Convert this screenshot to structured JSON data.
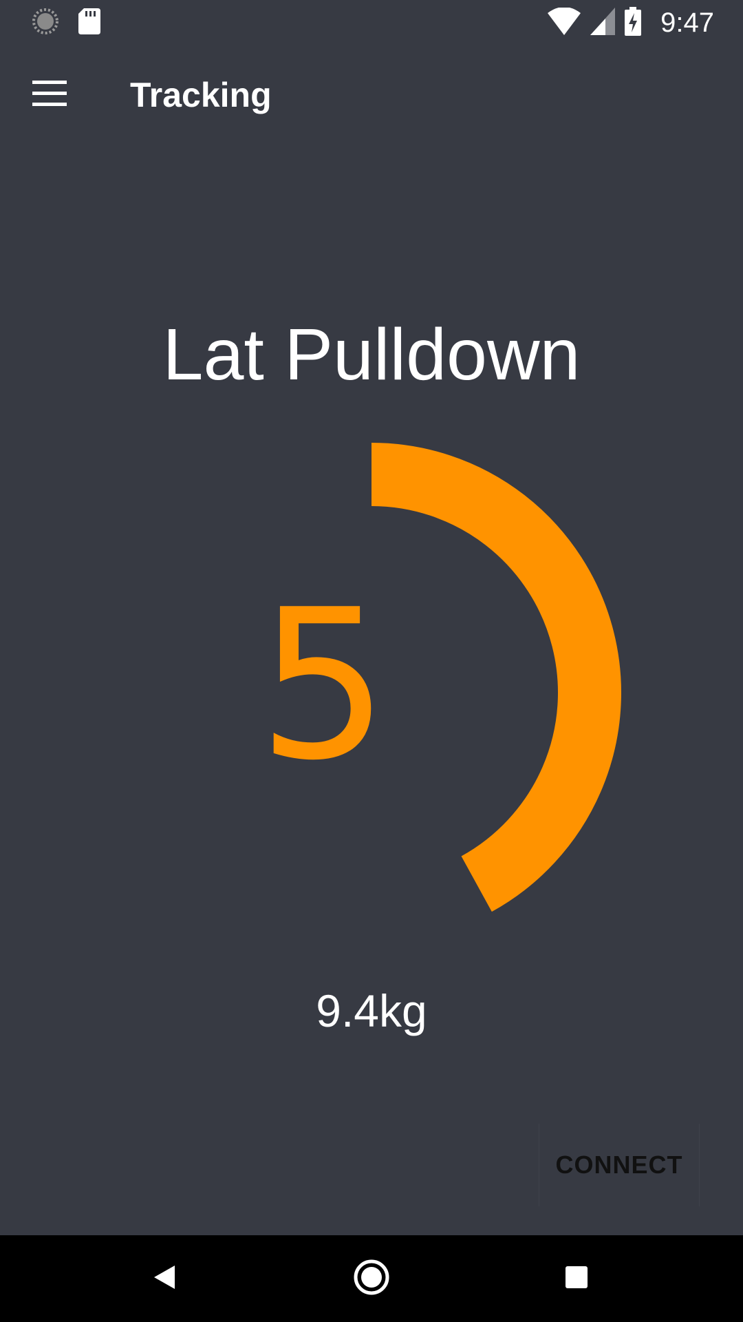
{
  "status_bar": {
    "time": "9:47",
    "icons": [
      "loading-spinner-icon",
      "sd-card-icon",
      "wifi-icon",
      "cell-signal-icon",
      "battery-charging-icon"
    ]
  },
  "app_bar": {
    "menu_icon": "hamburger-menu-icon",
    "title": "Tracking"
  },
  "tracker": {
    "exercise_name": "Lat Pulldown",
    "rep_count": "5",
    "weight": "9.4kg",
    "progress_fraction": 0.42,
    "accent_color": "#ff9300"
  },
  "actions": {
    "connect_label": "CONNECT"
  },
  "nav_bar": {
    "icons": [
      "back-icon",
      "home-icon",
      "recents-icon"
    ]
  }
}
